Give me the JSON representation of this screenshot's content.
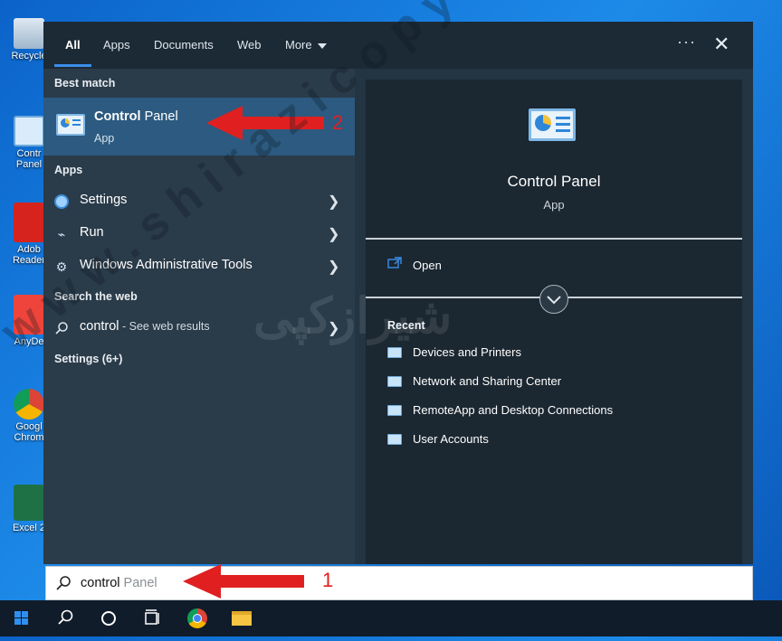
{
  "desktop": {
    "icons": [
      {
        "label": "Recycle"
      },
      {
        "label": "Contr Panel"
      },
      {
        "label": "Adob Reader"
      },
      {
        "label": "AnyDe"
      },
      {
        "label": "Googl Chrom"
      },
      {
        "label": "Excel 2"
      }
    ]
  },
  "tabs": [
    {
      "label": "All"
    },
    {
      "label": "Apps"
    },
    {
      "label": "Documents"
    },
    {
      "label": "Web"
    },
    {
      "label": "More"
    }
  ],
  "header": {
    "more_options": "···",
    "close": "✕"
  },
  "left": {
    "best_match_heading": "Best match",
    "best_match": {
      "title_bold": "Control",
      "title_rest": " Panel",
      "subtitle": "App"
    },
    "apps_heading": "Apps",
    "apps": [
      {
        "label": "Settings",
        "icon": "gear-icon"
      },
      {
        "label": "Run",
        "icon": "run-icon"
      },
      {
        "label": "Windows Administrative Tools",
        "icon": "admin-tools-icon"
      }
    ],
    "web_heading": "Search the web",
    "web_result": {
      "query": "control",
      "suffix": " - See web results"
    },
    "settings_heading": "Settings (6+)"
  },
  "right": {
    "title": "Control Panel",
    "subtitle": "App",
    "open_label": "Open",
    "recent_heading": "Recent",
    "recent": [
      {
        "label": "Devices and Printers"
      },
      {
        "label": "Network and Sharing Center"
      },
      {
        "label": "RemoteApp and Desktop Connections"
      },
      {
        "label": "User Accounts"
      }
    ]
  },
  "search": {
    "typed": "control",
    "autocomplete": " Panel"
  },
  "annotations": {
    "one": "1",
    "two": "2"
  },
  "watermark": {
    "text": "www.shirazicopy.com",
    "logo_text": "شیرازکپی"
  },
  "colors": {
    "accent": "#3b8eea",
    "selected": "#2c5a80",
    "arrow": "#e02020"
  }
}
